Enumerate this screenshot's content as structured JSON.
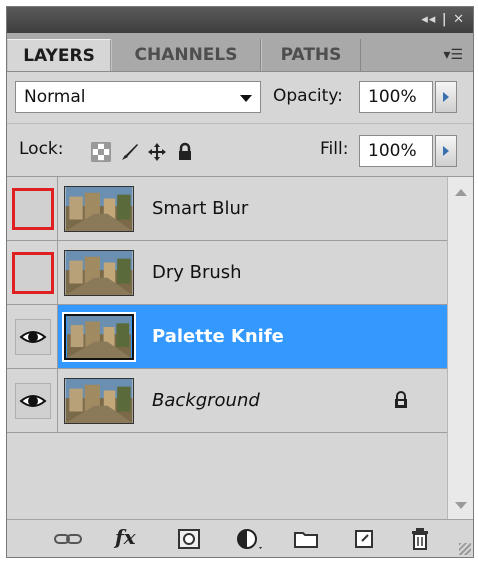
{
  "titlebar": {
    "controls": "◂◂ | ✕"
  },
  "tabs": [
    {
      "label": "LAYERS",
      "active": true
    },
    {
      "label": "CHANNELS",
      "active": false
    },
    {
      "label": "PATHS",
      "active": false
    }
  ],
  "tab_menu_icon": "panel-menu-icon",
  "blend_mode": {
    "value": "Normal"
  },
  "opacity": {
    "label": "Opacity:",
    "value": "100%"
  },
  "lock": {
    "label": "Lock:",
    "icons": [
      "lock-transparent-icon",
      "lock-image-icon",
      "lock-position-icon",
      "lock-all-icon"
    ]
  },
  "fill": {
    "label": "Fill:",
    "value": "100%"
  },
  "layers": [
    {
      "name": "Smart Blur",
      "visible": false,
      "selected": false,
      "locked": false,
      "italic": false
    },
    {
      "name": "Dry Brush",
      "visible": false,
      "selected": false,
      "locked": false,
      "italic": false
    },
    {
      "name": "Palette Knife",
      "visible": true,
      "selected": true,
      "locked": false,
      "italic": false
    },
    {
      "name": "Background",
      "visible": true,
      "selected": false,
      "locked": true,
      "italic": true
    }
  ],
  "bottom_icons": [
    "link-layers-icon",
    "fx-icon",
    "layer-mask-icon",
    "adjustment-layer-icon",
    "new-group-icon",
    "new-layer-icon",
    "trash-icon"
  ],
  "bottom_fx_label": "fx",
  "colors": {
    "selection": "#3399ff",
    "highlight": "#e02020"
  }
}
